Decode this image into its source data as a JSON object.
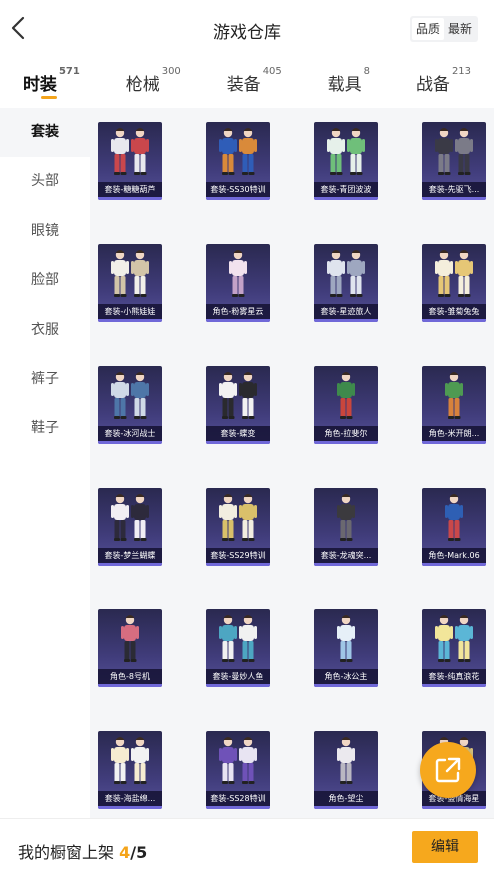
{
  "header": {
    "title": "游戏仓库",
    "sort_options": [
      "品质",
      "最新"
    ],
    "active_sort": 0
  },
  "tabs": [
    {
      "label": "时装",
      "count": "571",
      "active": true
    },
    {
      "label": "枪械",
      "count": "300",
      "active": false
    },
    {
      "label": "装备",
      "count": "405",
      "active": false
    },
    {
      "label": "载具",
      "count": "8",
      "active": false
    },
    {
      "label": "战备",
      "count": "213",
      "active": false
    }
  ],
  "sidebar": {
    "items": [
      "套装",
      "头部",
      "眼镜",
      "脸部",
      "衣服",
      "裤子",
      "鞋子"
    ],
    "active": 0
  },
  "items": [
    {
      "label": "套装-糖糖葫芦",
      "colors": [
        "#e8e8ee",
        "#c9474c"
      ],
      "figures": 2
    },
    {
      "label": "套装-SS30特训",
      "colors": [
        "#2f5db8",
        "#d98a3a"
      ],
      "figures": 2
    },
    {
      "label": "套装-青团波波",
      "colors": [
        "#e6f0ea",
        "#6fbf7a"
      ],
      "figures": 2
    },
    {
      "label": "套装-先驱飞...",
      "colors": [
        "#3a3a46",
        "#7b7b88"
      ],
      "figures": 2
    },
    {
      "label": "套装-小熊娃娃",
      "colors": [
        "#f1efe9",
        "#d2c4a8"
      ],
      "figures": 2
    },
    {
      "label": "角色-粉雾星云",
      "colors": [
        "#f2e2ee",
        "#c3a2c8"
      ],
      "figures": 1
    },
    {
      "label": "套装-星迹旅人",
      "colors": [
        "#dfe4ee",
        "#9ea7c0"
      ],
      "figures": 2
    },
    {
      "label": "套装-雏菊兔兔",
      "colors": [
        "#f4eedc",
        "#e6c776"
      ],
      "figures": 2
    },
    {
      "label": "套装-冰河战士",
      "colors": [
        "#cfd9e6",
        "#4e76a8"
      ],
      "figures": 2
    },
    {
      "label": "套装-蝶变",
      "colors": [
        "#f2f2f2",
        "#2a2a2e"
      ],
      "figures": 2
    },
    {
      "label": "角色-拉斐尔",
      "colors": [
        "#3e8a4c",
        "#c9463c"
      ],
      "figures": 1
    },
    {
      "label": "角色-米开朗...",
      "colors": [
        "#4e9a52",
        "#d7823c"
      ],
      "figures": 1
    },
    {
      "label": "套装-梦兰蝴蝶",
      "colors": [
        "#f1eef4",
        "#2d2a3c"
      ],
      "figures": 2
    },
    {
      "label": "套装-SS29特训",
      "colors": [
        "#f2eee0",
        "#d9c06a"
      ],
      "figures": 2
    },
    {
      "label": "套装-龙魂突...",
      "colors": [
        "#3b3a3e",
        "#6a6870"
      ],
      "figures": 1
    },
    {
      "label": "角色-Mark.06",
      "colors": [
        "#2e5fb4",
        "#c9484a"
      ],
      "figures": 1
    },
    {
      "label": "角色-8号机",
      "colors": [
        "#d76d80",
        "#2b2b35"
      ],
      "figures": 1
    },
    {
      "label": "套装-曼妙人鱼",
      "colors": [
        "#4da6c2",
        "#f1f1f1"
      ],
      "figures": 2
    },
    {
      "label": "角色-冰公主",
      "colors": [
        "#e6f0f8",
        "#9fc6e6"
      ],
      "figures": 1
    },
    {
      "label": "套装-纯真浪花",
      "colors": [
        "#f2e69a",
        "#5bb6d6"
      ],
      "figures": 2
    },
    {
      "label": "套装-海盐绵...",
      "colors": [
        "#f6ecd2",
        "#f2f2f2"
      ],
      "figures": 2
    },
    {
      "label": "套装-SS28特训",
      "colors": [
        "#6f52b8",
        "#e8e4f2"
      ],
      "figures": 2
    },
    {
      "label": "角色-望尘",
      "colors": [
        "#ebe9ee",
        "#b9b7c2"
      ],
      "figures": 1
    },
    {
      "label": "套装-盛情海星",
      "colors": [
        "#f2ead8",
        "#d6c07a"
      ],
      "figures": 2
    }
  ],
  "share_icon": "share-external-icon",
  "bottom_bar": {
    "label": "我的橱窗上架",
    "current": "4",
    "separator": "/",
    "total": "5",
    "edit_label": "编辑"
  },
  "accent_color": "#f4a41b"
}
